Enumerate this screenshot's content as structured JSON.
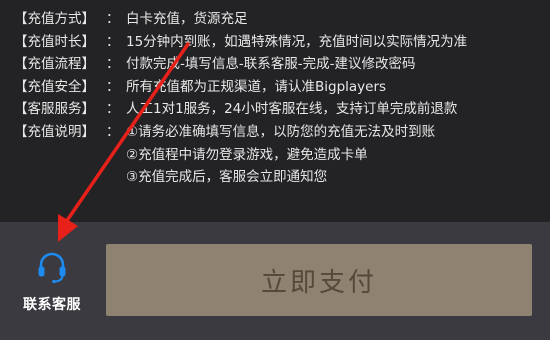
{
  "info": {
    "rows": [
      {
        "key": "【充值方式】",
        "sep": "：",
        "lines": [
          "白卡充值，货源充足"
        ]
      },
      {
        "key": "【充值时长】",
        "sep": "：",
        "lines": [
          "15分钟内到账，如遇特殊情况，充值时间以实际情况为准"
        ]
      },
      {
        "key": "【充值流程】",
        "sep": "：",
        "lines": [
          "付款完成-填写信息-联系客服-完成-建议修改密码"
        ]
      },
      {
        "key": "【充值安全】",
        "sep": "：",
        "lines": [
          "所有充值都为正规渠道，请认准Bigplayers"
        ]
      },
      {
        "key": "【客服服务】",
        "sep": "：",
        "lines": [
          "人工1对1服务，24小时客服在线，支持订单完成前退款"
        ]
      },
      {
        "key": "【充值说明】",
        "sep": "：",
        "lines": [
          "①请务必准确填写信息，以防您的充值无法及时到账",
          "②充值程中请勿登录游戏，避免造成卡单",
          "③充值完成后，客服会立即通知您"
        ]
      }
    ]
  },
  "footer": {
    "support_label": "联系客服",
    "pay_label": "立即支付",
    "icon": "headset-icon"
  },
  "colors": {
    "panel_bg": "#232326",
    "bar_bg": "#3a3a40",
    "pay_bg": "#8e8270",
    "pay_text": "#54493a",
    "headset_blue": "#1d8bf0",
    "arrow_red": "#e8201a"
  }
}
